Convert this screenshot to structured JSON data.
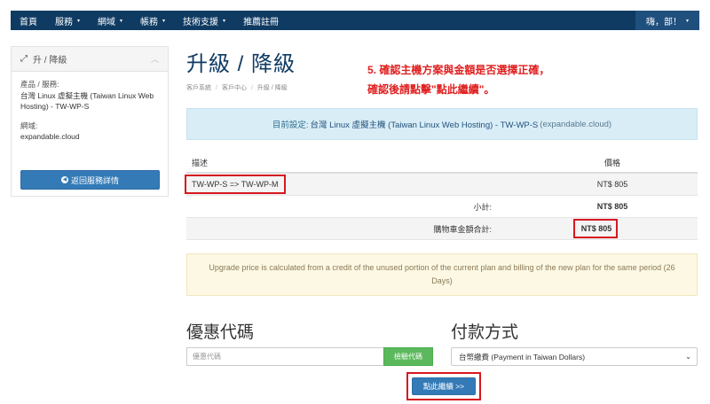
{
  "nav": {
    "items": [
      {
        "label": "首頁",
        "caret": false
      },
      {
        "label": "服務",
        "caret": true
      },
      {
        "label": "網域",
        "caret": true
      },
      {
        "label": "帳務",
        "caret": true
      },
      {
        "label": "技術支援",
        "caret": true
      },
      {
        "label": "推薦註冊",
        "caret": false
      }
    ],
    "user_label": "嗨，部！",
    "caret_glyph": "▾"
  },
  "sidebar": {
    "title": "升 / 降級",
    "product_label": "產品 / 服務:",
    "product_value": "台灣 Linux 虛擬主機 (Taiwan Linux Web Hosting) - TW-WP-S",
    "domain_label": "網域:",
    "domain_value": "expandable.cloud",
    "back_button": "返回服務詳情"
  },
  "main": {
    "title": "升級 / 降級",
    "breadcrumb": [
      "客戶系統",
      "客戶中心",
      "升級 / 降級"
    ],
    "annotation_line1": "5. 確認主機方案與金額是否選擇正確，",
    "annotation_line2": "確認後請點擊\"點此繼續\"。",
    "current": {
      "prefix": "目前設定:",
      "product": "台灣 Linux 虛擬主機 (Taiwan Linux Web Hosting) - TW-WP-S",
      "domain": "(expandable.cloud)"
    },
    "table": {
      "header_desc": "描述",
      "header_price": "價格",
      "item_desc": "TW-WP-S => TW-WP-M",
      "item_price": "NT$ 805",
      "subtotal_label": "小計:",
      "subtotal_value": "NT$ 805",
      "total_label": "購物車金額合計:",
      "total_value": "NT$ 805"
    },
    "notice": "Upgrade price is calculated from a credit of the unused portion of the current plan and billing of the new plan for the same period (26 Days)",
    "promo": {
      "title": "優惠代碼",
      "placeholder": "優惠代碼",
      "button": "檢驗代碼"
    },
    "payment": {
      "title": "付款方式",
      "selected": "台幣繳費 (Payment in Taiwan Dollars)"
    },
    "checkout_button": "點此繼續 >>"
  },
  "colors": {
    "nav_bg": "#0f3b63",
    "title": "#0f3b63",
    "primary": "#337ab7",
    "success": "#5cb85c",
    "highlight": "#d6181f",
    "annotation": "#e02020"
  }
}
